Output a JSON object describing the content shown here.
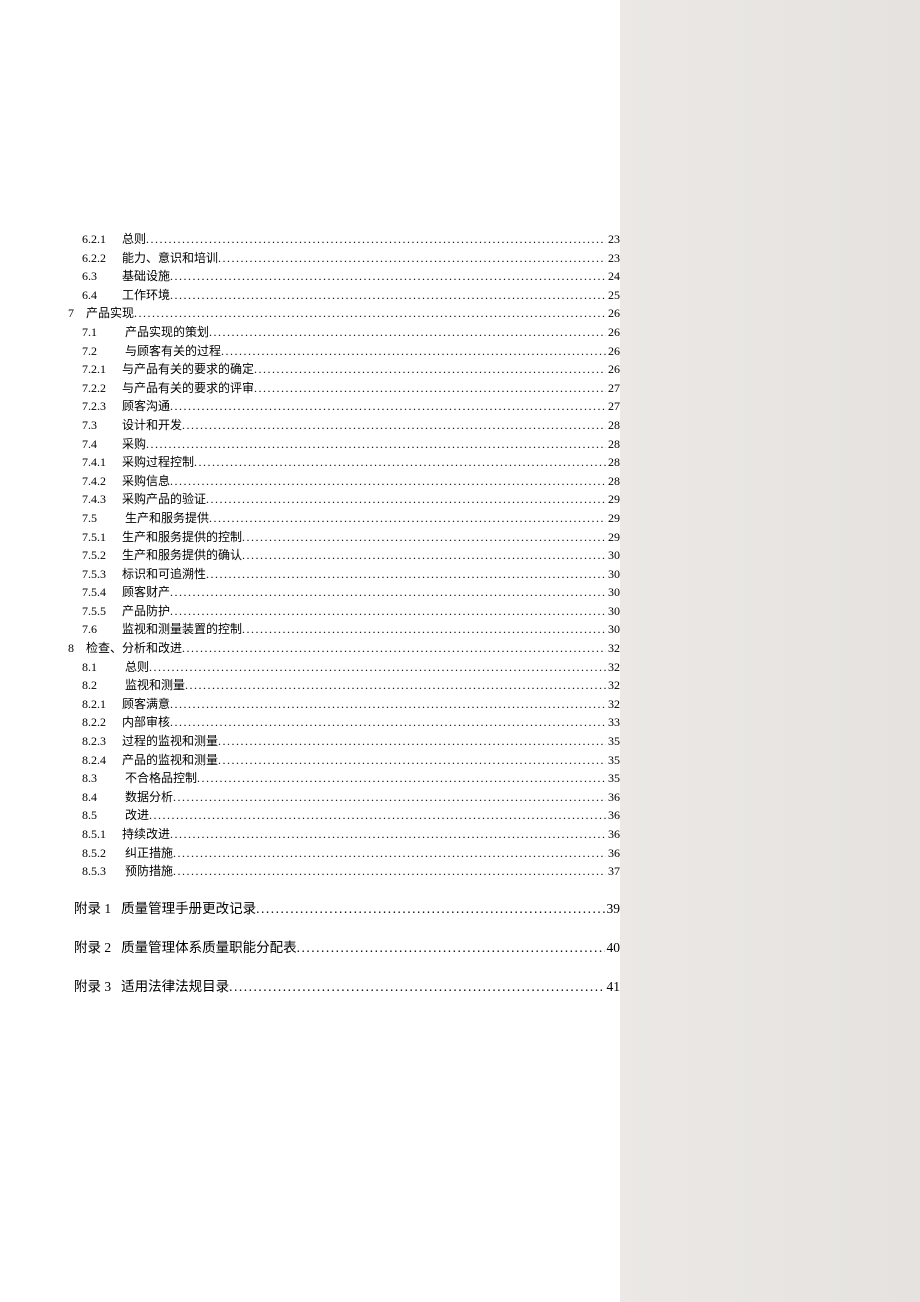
{
  "toc": [
    {
      "num": "6.2.1",
      "title": "总则",
      "page": "23",
      "indent": "indent-2"
    },
    {
      "num": "6.2.2",
      "title": "能力、意识和培训",
      "page": "23",
      "indent": "indent-2"
    },
    {
      "num": "6.3",
      "title": "基础设施",
      "page": "24",
      "indent": "indent-2"
    },
    {
      "num": "6.4",
      "title": "工作环境",
      "page": "25",
      "indent": "indent-2"
    },
    {
      "num": "7",
      "title": "产品实现",
      "page": "26",
      "indent": "",
      "sec": true
    },
    {
      "num": "7.1",
      "title": " 产品实现的策划",
      "page": "26",
      "indent": "indent-2"
    },
    {
      "num": "7.2",
      "title": " 与顾客有关的过程",
      "page": "26",
      "indent": "indent-2"
    },
    {
      "num": "7.2.1",
      "title": "与产品有关的要求的确定",
      "page": "26",
      "indent": "indent-2"
    },
    {
      "num": "7.2.2",
      "title": "与产品有关的要求的评审",
      "page": "27",
      "indent": "indent-2"
    },
    {
      "num": "7.2.3",
      "title": "顾客沟通",
      "page": "27",
      "indent": "indent-2"
    },
    {
      "num": "7.3",
      "title": "设计和开发",
      "page": "28",
      "indent": "indent-2"
    },
    {
      "num": "7.4",
      "title": "采购",
      "page": "28",
      "indent": "indent-2"
    },
    {
      "num": "7.4.1",
      "title": "采购过程控制",
      "page": "28",
      "indent": "indent-2"
    },
    {
      "num": "7.4.2",
      "title": "采购信息",
      "page": "28",
      "indent": "indent-2"
    },
    {
      "num": "7.4.3",
      "title": "采购产品的验证",
      "page": "29",
      "indent": "indent-2"
    },
    {
      "num": "7.5",
      "title": " 生产和服务提供",
      "page": "29",
      "indent": "indent-2"
    },
    {
      "num": "7.5.1",
      "title": "生产和服务提供的控制",
      "page": "29",
      "indent": "indent-2"
    },
    {
      "num": "7.5.2",
      "title": "生产和服务提供的确认",
      "page": "30",
      "indent": "indent-2"
    },
    {
      "num": "7.5.3",
      "title": "标识和可追溯性",
      "page": "30",
      "indent": "indent-2"
    },
    {
      "num": "7.5.4",
      "title": "顾客财产",
      "page": "30",
      "indent": "indent-2"
    },
    {
      "num": "7.5.5",
      "title": "产品防护",
      "page": "30",
      "indent": "indent-2"
    },
    {
      "num": "7.6",
      "title": "监视和测量装置的控制",
      "page": "30",
      "indent": "indent-2"
    },
    {
      "num": "8",
      "title": "检查、分析和改进",
      "page": "32",
      "indent": "",
      "sec": true
    },
    {
      "num": "8.1",
      "title": " 总则",
      "page": "32",
      "indent": "indent-2"
    },
    {
      "num": "8.2",
      "title": " 监视和测量",
      "page": "32",
      "indent": "indent-2"
    },
    {
      "num": "8.2.1",
      "title": "顾客满意",
      "page": "32",
      "indent": "indent-2"
    },
    {
      "num": "8.2.2",
      "title": "内部审核",
      "page": "33",
      "indent": "indent-2"
    },
    {
      "num": "8.2.3",
      "title": "过程的监视和测量",
      "page": "35",
      "indent": "indent-2"
    },
    {
      "num": "8.2.4",
      "title": "产品的监视和测量",
      "page": "35",
      "indent": "indent-2"
    },
    {
      "num": "8.3",
      "title": " 不合格品控制",
      "page": "35",
      "indent": "indent-2"
    },
    {
      "num": "8.4",
      "title": " 数据分析",
      "page": "36",
      "indent": "indent-2"
    },
    {
      "num": "8.5",
      "title": " 改进",
      "page": "36",
      "indent": "indent-2"
    },
    {
      "num": "8.5.1",
      "title": "持续改进",
      "page": "36",
      "indent": "indent-2"
    },
    {
      "num": "8.5.2",
      "title": " 纠正措施",
      "page": "36",
      "indent": "indent-2"
    },
    {
      "num": "8.5.3",
      "title": " 预防措施",
      "page": "37",
      "indent": "indent-2"
    }
  ],
  "appendices": [
    {
      "num": "附录 1",
      "title": "质量管理手册更改记录",
      "page": "39"
    },
    {
      "num": "附录 2",
      "title": "质量管理体系质量职能分配表",
      "page": "40"
    },
    {
      "num": "附录 3",
      "title": "适用法律法规目录",
      "page": "41"
    }
  ]
}
